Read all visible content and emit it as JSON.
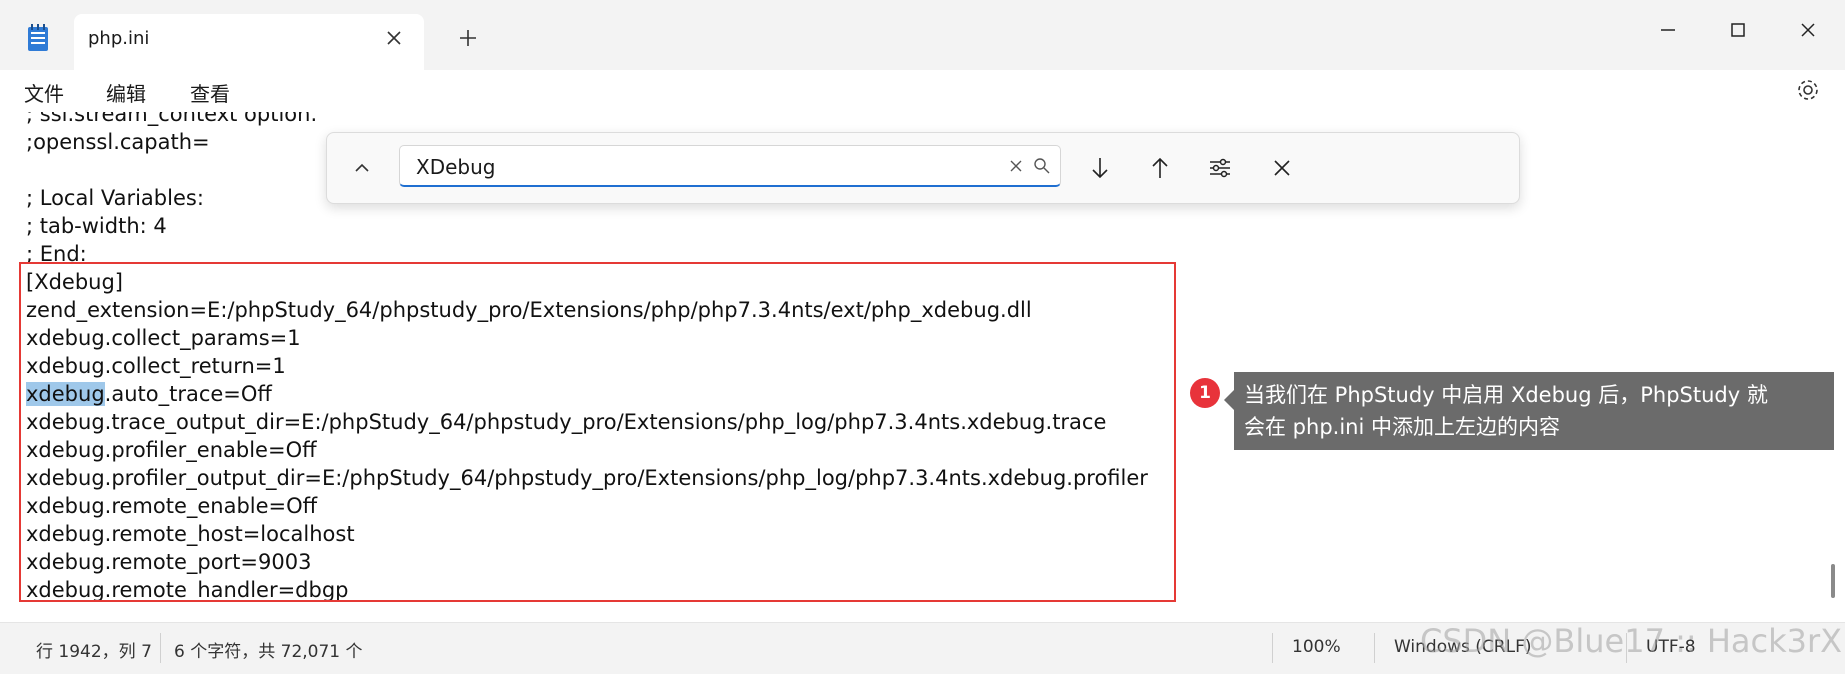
{
  "titlebar": {
    "tab_title": "php.ini"
  },
  "menu": {
    "items": [
      "文件",
      "编辑",
      "查看"
    ]
  },
  "editor": {
    "lines": [
      "; ssl.stream_context option.",
      ";openssl.capath=",
      "",
      "; Local Variables:",
      "; tab-width: 4",
      "; End:",
      "[Xdebug]",
      "zend_extension=E:/phpStudy_64/phpstudy_pro/Extensions/php/php7.3.4nts/ext/php_xdebug.dll",
      "xdebug.collect_params=1",
      "xdebug.collect_return=1",
      "xdebug",
      "xdebug.trace_output_dir=E:/phpStudy_64/phpstudy_pro/Extensions/php_log/php7.3.4nts.xdebug.trace",
      "xdebug.profiler_enable=Off",
      "xdebug.profiler_output_dir=E:/phpStudy_64/phpstudy_pro/Extensions/php_log/php7.3.4nts.xdebug.profiler",
      "xdebug.remote_enable=Off",
      "xdebug.remote_host=localhost",
      "xdebug.remote_port=9003",
      "xdebug.remote_handler=dbgp"
    ],
    "highlight_rest": ".auto_trace=Off"
  },
  "find": {
    "query": "XDebug"
  },
  "annotation": {
    "badge": "1",
    "text_line1": "当我们在 PhpStudy 中启用 Xdebug 后，PhpStudy 就",
    "text_line2": "会在 php.ini 中添加上左边的内容"
  },
  "status": {
    "position": "行 1942，列 7",
    "chars": "6 个字符，共 72,071 个",
    "zoom": "100%",
    "eol": "Windows (CRLF)",
    "encoding": "UTF-8"
  },
  "watermark": "CSDN @Blue17 :: Hack3rX",
  "colors": {
    "highlight": "#9fc8ea",
    "annotation_box": "#e53935",
    "find_focus": "#1f6fd1"
  }
}
